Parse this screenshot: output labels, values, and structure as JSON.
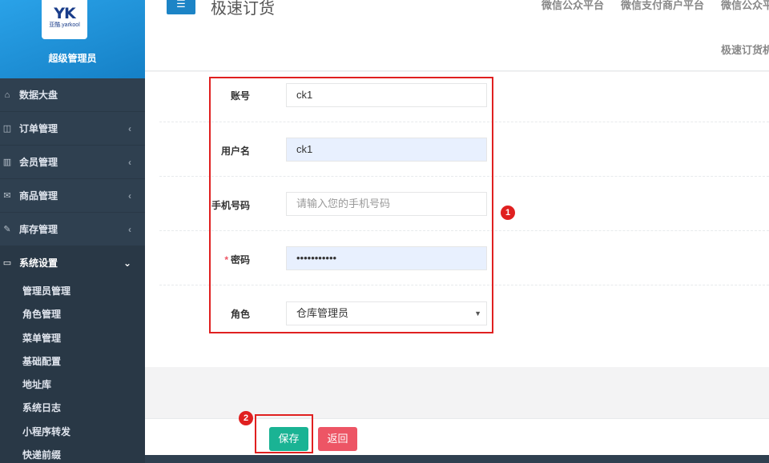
{
  "sidebar": {
    "logo_mark": "YK",
    "logo_text": "亚酷.yarkool",
    "admin_name": "超级管理员",
    "items": [
      {
        "label": "数据大盘",
        "icon": "home-icon",
        "glyph": "⌂",
        "arrow": ""
      },
      {
        "label": "订单管理",
        "icon": "columns-icon",
        "glyph": "◫",
        "arrow": "‹"
      },
      {
        "label": "会员管理",
        "icon": "bar-chart-icon",
        "glyph": "▥",
        "arrow": "‹"
      },
      {
        "label": "商品管理",
        "icon": "envelope-icon",
        "glyph": "✉",
        "arrow": "‹"
      },
      {
        "label": "库存管理",
        "icon": "edit-icon",
        "glyph": "✎",
        "arrow": "‹"
      },
      {
        "label": "系统设置",
        "icon": "desktop-icon",
        "glyph": "▭",
        "arrow": "⌄"
      }
    ],
    "sub_items": [
      "管理员管理",
      "角色管理",
      "菜单管理",
      "基础配置",
      "地址库",
      "系统日志",
      "小程序转发",
      "快递前缀"
    ]
  },
  "header": {
    "menu_icon": "☰",
    "title": "极速订货",
    "links": [
      "微信公众平台",
      "微信支付商户平台",
      "微信公众平"
    ],
    "link2": "极速订货机"
  },
  "form": {
    "account": {
      "label": "账号",
      "value": "ck1"
    },
    "username": {
      "label": "用户名",
      "value": "ck1"
    },
    "phone": {
      "label": "手机号码",
      "placeholder": "请输入您的手机号码"
    },
    "password": {
      "required": "*",
      "label": "密码",
      "value": "•••••••••••"
    },
    "role": {
      "label": "角色",
      "value": "仓库管理员"
    }
  },
  "footer": {
    "save_label": "保存",
    "back_label": "返回"
  },
  "annotations": {
    "badge1": "1",
    "badge2": "2",
    "color": "#e02020"
  },
  "colors": {
    "sidebar_bg": "#2f4050",
    "header_blue": "#1c84c6",
    "save_green": "#1ab394",
    "back_red": "#ed5565"
  }
}
